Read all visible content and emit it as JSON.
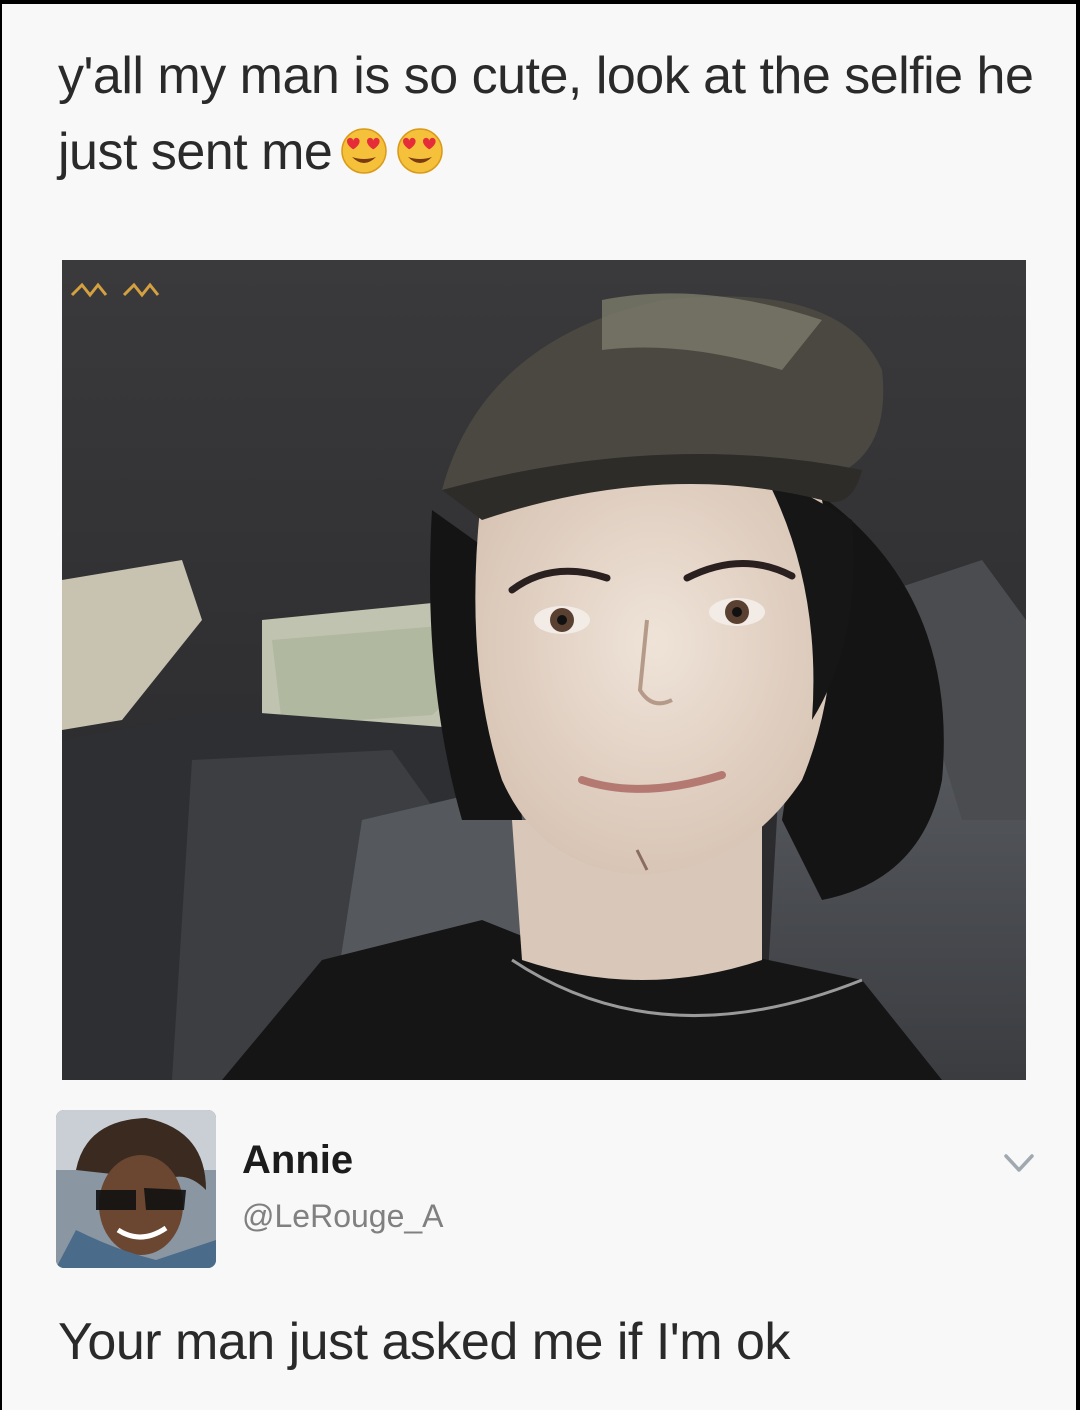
{
  "tweet": {
    "text": "y'all my man is so cute, look at the selfie he just sent me",
    "emojis": [
      "heart-eyes-emoji",
      "heart-eyes-emoji"
    ],
    "photo_caption_watermark": "ᴍᴍ"
  },
  "author": {
    "name": "Annie",
    "handle": "@LeRouge_A"
  },
  "reply": {
    "text": "Your man just asked me if I'm ok"
  },
  "colors": {
    "background": "#f8f8f8",
    "text": "#2a2a2a",
    "handle": "#808080",
    "chevron": "#a0a8b0"
  }
}
